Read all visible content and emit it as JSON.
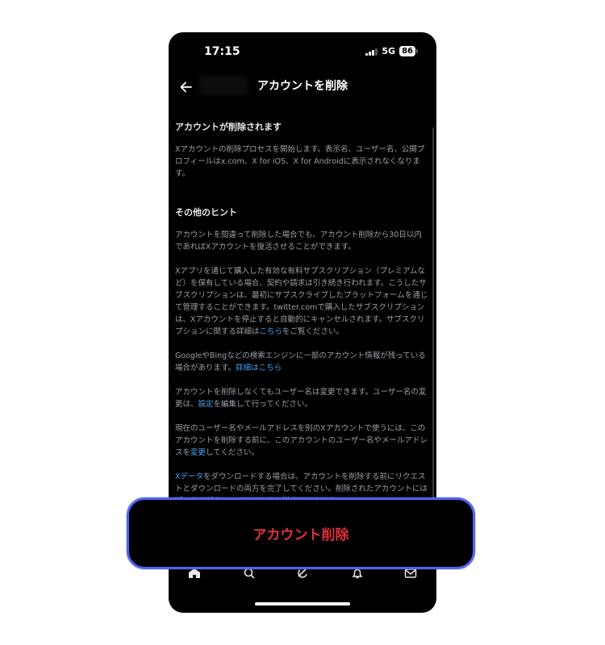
{
  "status_bar": {
    "time": "17:15",
    "network": "5G",
    "battery": "86"
  },
  "header": {
    "title": "アカウントを削除"
  },
  "section1": {
    "heading": "アカウントが削除されます",
    "body": "Xアカウントの削除プロセスを開始します。表示名、ユーザー名、公開プロフィールはx.com、X for iOS、X for Androidに表示されなくなります。"
  },
  "section2": {
    "heading": "その他のヒント",
    "p1": "アカウントを間違って削除した場合でも、アカウント削除から30日以内であればXアカウントを復活させることができます。",
    "p2": "Xアプリを通じて購入した有効な有料サブスクリプション（プレミアムなど）を保有している場合、契約や請求は引き続き行われます。こうしたサブスクリプションは、最初にサブスクライブしたプラットフォームを通じて管理することができます。twitter.comで購入したサブスクリプションは、Xアカウントを停止すると自動的にキャンセルされます。サブスクリプションに関する詳細は",
    "p2_link": "こちら",
    "p2_end": "をご覧ください。",
    "p3": "GoogleやBingなどの検索エンジンに一部のアカウント情報が残っている場合があります。",
    "p3_link": "詳細はこちら",
    "p4_start": "アカウントを削除しなくてもユーザー名は変更できます。ユーザー名の変更は、",
    "p4_link": "設定",
    "p4_end": "を編集して行ってください。",
    "p5_start": "現在のユーザー名やメールアドレスを別のXアカウントで使うには、このアカウントを削除する前に、このアカウントのユーザー名やメールアドレスを",
    "p5_link": "変更",
    "p5_end": "してください。",
    "p6_link": "Xデータ",
    "p6_end": "をダウンロードする場合は、アカウントを削除する前にリクエストとダウンロードの両方を完了してください。削除されたアカウントにはデータのダウンロードリンクを送信できません。"
  },
  "action": {
    "delete_label": "アカウント削除"
  },
  "tabbar": {
    "icons": [
      "home-icon",
      "search-icon",
      "grok-icon",
      "notifications-icon",
      "messages-icon"
    ]
  }
}
